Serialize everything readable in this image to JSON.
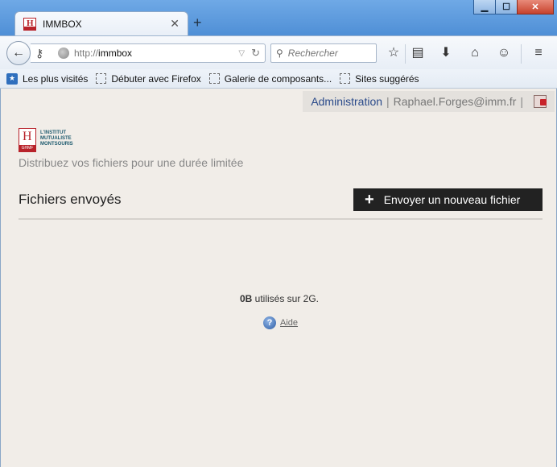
{
  "browser": {
    "tab_title": "IMMBOX",
    "new_tab_symbol": "+",
    "url_prefix": "http://",
    "url_host": "immbox",
    "search_placeholder": "Rechercher",
    "bookmarks": [
      "Les plus visités",
      "Débuter avec Firefox",
      "Galerie de composants...",
      "Sites suggérés"
    ]
  },
  "header": {
    "admin_link": "Administration",
    "user_email": "Raphael.Forges@imm.fr",
    "separator": "|"
  },
  "logo": {
    "band_text": "GHMF",
    "line1": "L'INSTITUT",
    "line2": "MUTUALISTE",
    "line3": "MONTSOURIS"
  },
  "main": {
    "tagline": "Distribuez vos fichiers pour une durée limitée",
    "section_title": "Fichiers envoyés",
    "upload_button": "Envoyer un nouveau fichier",
    "usage_used": "0B",
    "usage_rest": " utilisés sur 2G.",
    "help_label": "Aide"
  },
  "colors": {
    "page_bg": "#f1ede8",
    "button_bg": "#222222",
    "link": "#2a4a8a",
    "brand_red": "#b8222a"
  }
}
